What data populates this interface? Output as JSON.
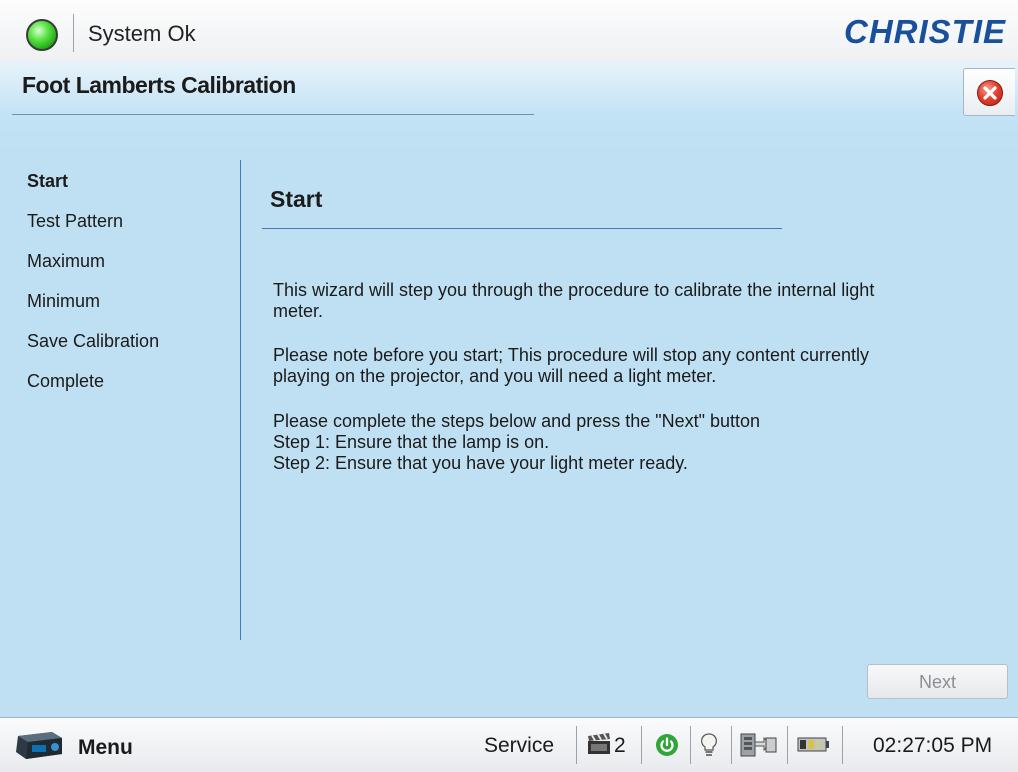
{
  "header": {
    "status_text": "System Ok",
    "brand": "CHRISTIE",
    "status_color": "#2fc21f",
    "brand_color": "#1a4f9c"
  },
  "page": {
    "title": "Foot Lamberts Calibration",
    "close_icon": "close-icon"
  },
  "steps": [
    {
      "label": "Start",
      "active": true
    },
    {
      "label": "Test Pattern",
      "active": false
    },
    {
      "label": "Maximum",
      "active": false
    },
    {
      "label": "Minimum",
      "active": false
    },
    {
      "label": "Save Calibration",
      "active": false
    },
    {
      "label": "Complete",
      "active": false
    }
  ],
  "content": {
    "title": "Start",
    "para1": [
      "This wizard will step you through the procedure to calibrate the internal light",
      "meter."
    ],
    "para2": [
      "Please note before you start; This procedure will stop any content currently",
      "playing on the projector, and you will need a light meter."
    ],
    "para3": [
      "Please complete the steps below and press the \"Next\" button",
      "Step 1: Ensure that the lamp is on.",
      "Step 2: Ensure that you have your light meter ready."
    ]
  },
  "buttons": {
    "next": "Next"
  },
  "footer": {
    "menu_label": "Menu",
    "service_label": "Service",
    "clapper_count": "2",
    "clock": "02:27:05 PM",
    "icons": [
      "projector-icon",
      "clapperboard-icon",
      "power-icon",
      "lightbulb-icon",
      "network-icon",
      "battery-icon"
    ]
  }
}
